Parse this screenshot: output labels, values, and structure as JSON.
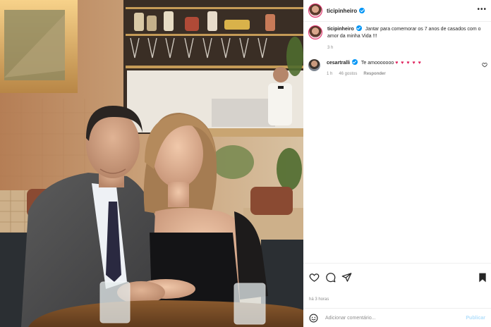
{
  "post": {
    "username": "ticipinheiro",
    "caption_text": "Jantar para comemorar os 7 anos de casados com o amor da minha Vida !!!",
    "caption_age": "3 h",
    "more_glyph": "•••"
  },
  "comments": [
    {
      "username": "cesartralli",
      "text": "Te amooooooo",
      "hearts": "♥ ♥ ♥ ♥ ♥",
      "age": "1 h",
      "likes": "46 gostos",
      "reply": "Responder"
    }
  ],
  "footer": {
    "timestamp": "há 3 horas",
    "comment_placeholder": "Adicionar comentário...",
    "publish_label": "Publicar"
  },
  "icons": {
    "like": "heart-outline-icon",
    "comment": "speech-bubble-icon",
    "share": "paper-plane-icon",
    "save": "bookmark-filled-icon",
    "emoji": "emoji-icon",
    "verified": "verified-badge-icon"
  },
  "colors": {
    "verified": "#0095f6",
    "hearts": "#e0245e",
    "secondary_text": "#8e8e8e",
    "publish_disabled": "#b2dffc"
  }
}
